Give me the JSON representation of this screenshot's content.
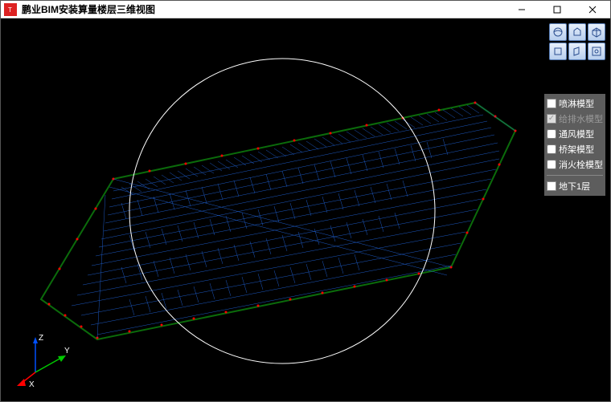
{
  "titlebar": {
    "title": "鹏业BIM安装算量楼层三维视图",
    "icon_letter": "T"
  },
  "toolbar": {
    "r1c1": "orbit",
    "r1c2": "cube-top",
    "r1c3": "cube-iso",
    "r2c1": "cube-front",
    "r2c2": "cube-side",
    "r2c3": "cube-fit"
  },
  "layers": [
    {
      "label": "喷淋模型",
      "checked": true,
      "disabled": false
    },
    {
      "label": "给排水模型",
      "checked": true,
      "disabled": true
    },
    {
      "label": "通风模型",
      "checked": false,
      "disabled": false
    },
    {
      "label": "桥架模型",
      "checked": false,
      "disabled": false
    },
    {
      "label": "消火栓模型",
      "checked": false,
      "disabled": false
    }
  ],
  "floors": [
    {
      "label": "地下1层",
      "checked": true
    }
  ],
  "axes": {
    "x": "X",
    "y": "Y",
    "z": "Z"
  }
}
